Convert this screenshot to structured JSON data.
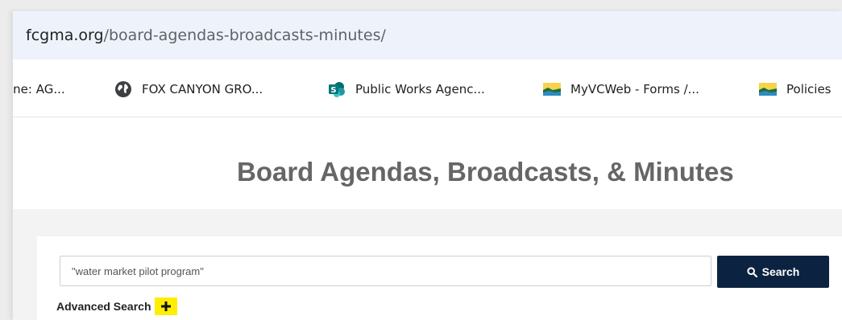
{
  "browser": {
    "address_bar": {
      "domain": "fcgma.org",
      "path": "/board-agendas-broadcasts-minutes/"
    },
    "bookmarks": [
      {
        "label": "ine: AG...",
        "icon": "none"
      },
      {
        "label": "FOX CANYON GRO...",
        "icon": "globe-icon"
      },
      {
        "label": "Public Works Agenc...",
        "icon": "sharepoint-icon"
      },
      {
        "label": "MyVCWeb - Forms /...",
        "icon": "landscape-icon"
      },
      {
        "label": "Policies",
        "icon": "landscape-icon"
      }
    ]
  },
  "page": {
    "title": "Board Agendas, Broadcasts, & Minutes",
    "search": {
      "value": "\"water market pilot program\"",
      "button_label": "Search",
      "advanced_label": "Advanced Search"
    }
  },
  "colors": {
    "search_button_bg": "#0b2341",
    "title_text": "#666666",
    "highlight": "#ffee00",
    "address_bar_bg": "#eef3fb"
  }
}
